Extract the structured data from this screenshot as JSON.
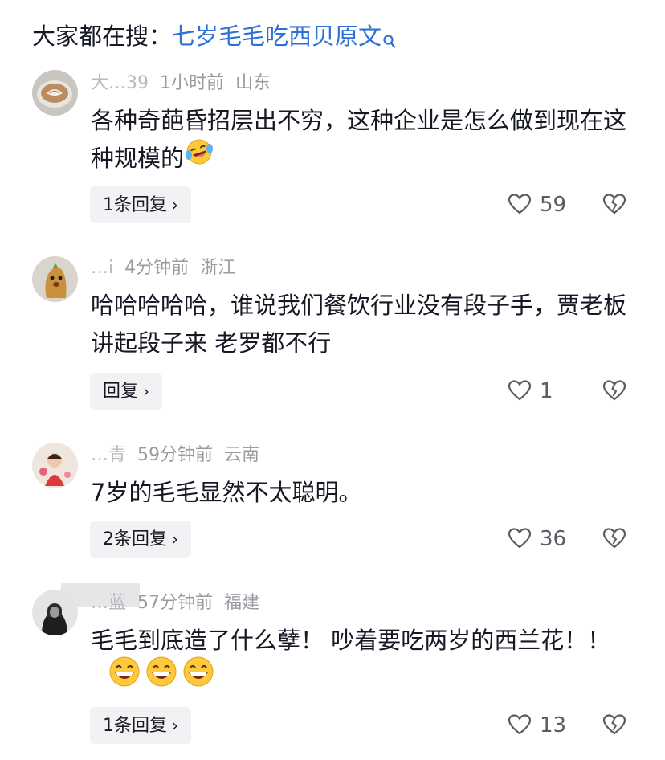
{
  "search_hint": {
    "prefix": "大家都在搜：",
    "term": "七岁毛毛吃西贝原文"
  },
  "comments": [
    {
      "username": "大…39",
      "time": "1小时前",
      "location": "山东",
      "text": "各种奇葩昏招层出不穷，这种企业是怎么做到现在这种规模的",
      "reply_label": "1条回复",
      "likes": "59"
    },
    {
      "username": "…i",
      "time": "4分钟前",
      "location": "浙江",
      "text": "哈哈哈哈哈，谁说我们餐饮行业没有段子手，贾老板讲起段子来 老罗都不行",
      "reply_label": "回复",
      "likes": "1"
    },
    {
      "username": "…青",
      "time": "59分钟前",
      "location": "云南",
      "text": "7岁的毛毛显然不太聪明。",
      "reply_label": "2条回复",
      "likes": "36"
    },
    {
      "username": "…蓝",
      "time": "57分钟前",
      "location": "福建",
      "text": "毛毛到底造了什么孽！ 吵着要吃两岁的西兰花！！",
      "reply_label": "1条回复",
      "likes": "13"
    }
  ],
  "colors": {
    "search_term": "#2f6fd8",
    "meta_text": "#9a9ba1",
    "reply_bg": "#f2f2f4"
  },
  "icons": [
    "search-icon",
    "heart-icon",
    "broken-heart-icon",
    "chevron-right-icon",
    "laughing-crying-emoji",
    "grinning-emoji"
  ]
}
